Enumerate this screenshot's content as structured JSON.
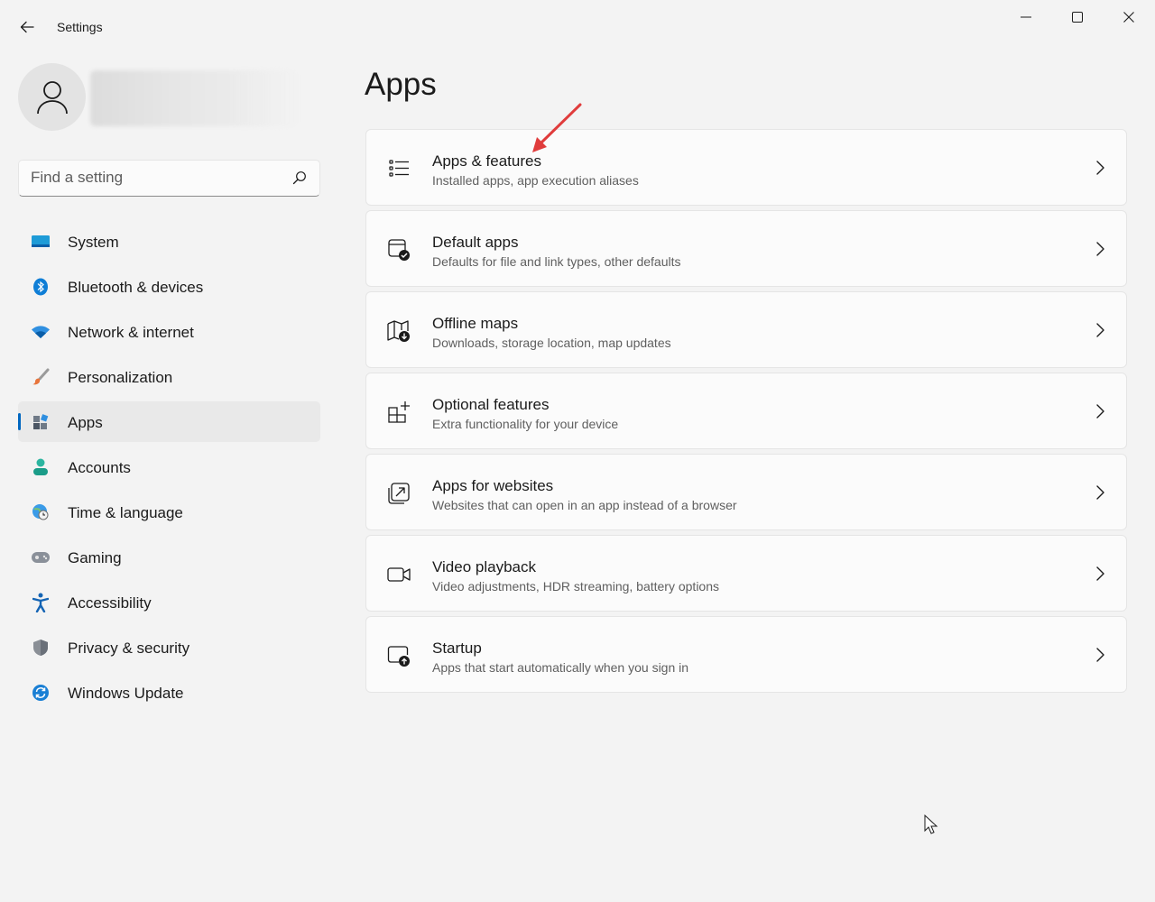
{
  "window": {
    "title": "Settings",
    "controls": [
      "minimize",
      "maximize",
      "close"
    ]
  },
  "search": {
    "placeholder": "Find a setting"
  },
  "sidebar": {
    "items": [
      {
        "label": "System",
        "icon": "system-icon",
        "active": false
      },
      {
        "label": "Bluetooth & devices",
        "icon": "bluetooth-icon",
        "active": false
      },
      {
        "label": "Network & internet",
        "icon": "wifi-icon",
        "active": false
      },
      {
        "label": "Personalization",
        "icon": "paintbrush-icon",
        "active": false
      },
      {
        "label": "Apps",
        "icon": "apps-icon",
        "active": true
      },
      {
        "label": "Accounts",
        "icon": "person-icon",
        "active": false
      },
      {
        "label": "Time & language",
        "icon": "globe-clock-icon",
        "active": false
      },
      {
        "label": "Gaming",
        "icon": "gamepad-icon",
        "active": false
      },
      {
        "label": "Accessibility",
        "icon": "accessibility-icon",
        "active": false
      },
      {
        "label": "Privacy & security",
        "icon": "shield-icon",
        "active": false
      },
      {
        "label": "Windows Update",
        "icon": "update-icon",
        "active": false
      }
    ]
  },
  "main": {
    "title": "Apps",
    "cards": [
      {
        "title": "Apps & features",
        "subtitle": "Installed apps, app execution aliases",
        "icon": "list-icon"
      },
      {
        "title": "Default apps",
        "subtitle": "Defaults for file and link types, other defaults",
        "icon": "default-apps-icon"
      },
      {
        "title": "Offline maps",
        "subtitle": "Downloads, storage location, map updates",
        "icon": "map-download-icon"
      },
      {
        "title": "Optional features",
        "subtitle": "Extra functionality for your device",
        "icon": "grid-add-icon"
      },
      {
        "title": "Apps for websites",
        "subtitle": "Websites that can open in an app instead of a browser",
        "icon": "open-in-app-icon"
      },
      {
        "title": "Video playback",
        "subtitle": "Video adjustments, HDR streaming, battery options",
        "icon": "video-icon"
      },
      {
        "title": "Startup",
        "subtitle": "Apps that start automatically when you sign in",
        "icon": "startup-icon"
      }
    ]
  },
  "colors": {
    "accent": "#0067c0",
    "annotation": "#e03c3c",
    "background": "#f3f3f3",
    "card": "#fbfbfb"
  }
}
